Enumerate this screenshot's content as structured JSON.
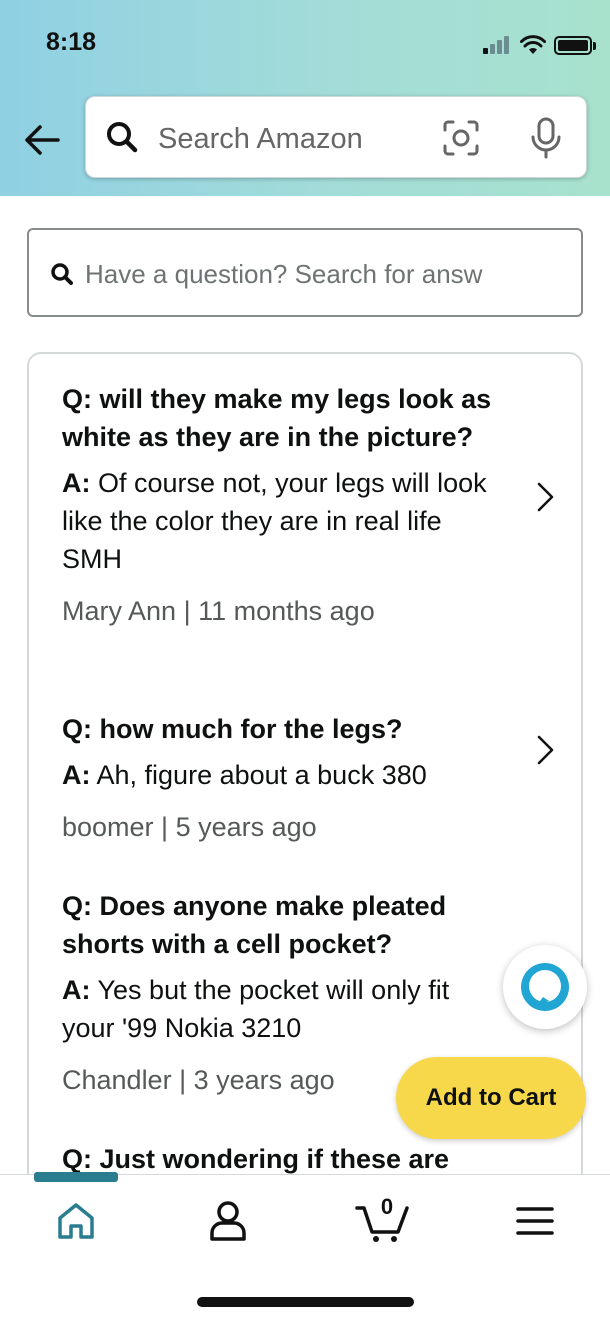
{
  "status_bar": {
    "time": "8:18"
  },
  "header": {
    "search_placeholder": "Search Amazon"
  },
  "qa_search": {
    "placeholder": "Have a question? Search for answ"
  },
  "qa_items": [
    {
      "question": "Q: will they make my legs look as white as they are in the picture?",
      "answer_prefix": "A:",
      "answer": " Of course not, your legs will look like the color they are in real life SMH",
      "author": "Mary Ann",
      "time": "11 months ago"
    },
    {
      "question": "Q: how much for the legs?",
      "answer_prefix": "A:",
      "answer": " Ah, figure about a buck 380",
      "author": "boomer",
      "time": "5 years ago"
    },
    {
      "question": "Q: Does anyone make pleated shorts with a cell pocket?",
      "answer_prefix": "A:",
      "answer": " Yes but the pocket will only fit your '99 Nokia 3210",
      "author": "Chandler",
      "time": "3 years ago"
    },
    {
      "question": "Q: Just wondering if these are"
    }
  ],
  "meta_separator": " | ",
  "add_to_cart": {
    "label": "Add to Cart"
  },
  "bottom_nav": {
    "cart_count": "0",
    "items": [
      "home-icon",
      "account-icon",
      "cart-icon",
      "menu-icon"
    ]
  },
  "colors": {
    "accent": "#2a7d8f",
    "cart_button": "#f7d84a"
  }
}
